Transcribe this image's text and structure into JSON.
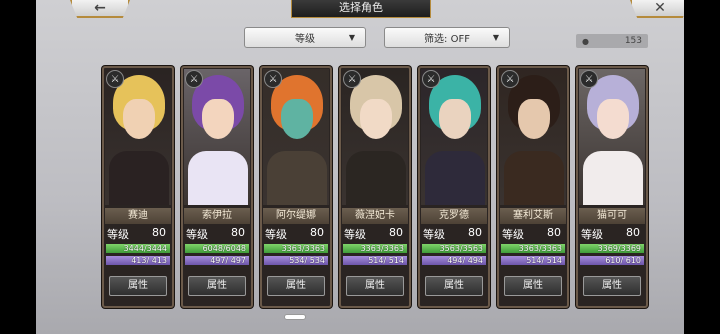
{
  "header": {
    "title": "选择角色",
    "back_icon": "←",
    "close_icon": "✕"
  },
  "controls": {
    "sort_label": "等级",
    "filter_label": "筛选: OFF",
    "dropdown_arrow": "▼",
    "character_count": "153",
    "person_icon": "👤"
  },
  "cards": [
    {
      "name": "赛迪",
      "level_label": "等级",
      "level": "80",
      "hp": "3444/3444",
      "mp": "413/ 413",
      "button": "属性",
      "hair": "#e6c25a",
      "skin": "#f0d1b3",
      "outfit": "#2a2222"
    },
    {
      "name": "索伊拉",
      "level_label": "等级",
      "level": "80",
      "hp": "6048/6048",
      "mp": "497/ 497",
      "button": "属性",
      "hair": "#7b4aa8",
      "skin": "#f3d5be",
      "outfit": "#e9e4f4"
    },
    {
      "name": "阿尔缇娜",
      "level_label": "等级",
      "level": "80",
      "hp": "3363/3363",
      "mp": "534/ 534",
      "button": "属性",
      "hair": "#e0742e",
      "skin": "#5fb3a2",
      "outfit": "#4a4036"
    },
    {
      "name": "薇涅妃卡",
      "level_label": "等级",
      "level": "80",
      "hp": "3363/3363",
      "mp": "514/ 514",
      "button": "属性",
      "hair": "#d8c6a8",
      "skin": "#f1dac6",
      "outfit": "#2b2622"
    },
    {
      "name": "克罗德",
      "level_label": "等级",
      "level": "80",
      "hp": "3563/3563",
      "mp": "494/ 494",
      "button": "属性",
      "hair": "#3bb3a6",
      "skin": "#ead3bf",
      "outfit": "#2e2a3a"
    },
    {
      "name": "塞利艾斯",
      "level_label": "等级",
      "level": "80",
      "hp": "3363/3363",
      "mp": "514/ 514",
      "button": "属性",
      "hair": "#2c1e18",
      "skin": "#e5c8ad",
      "outfit": "#3a2a20"
    },
    {
      "name": "猫可可",
      "level_label": "等级",
      "level": "80",
      "hp": "3369/3369",
      "mp": "610/ 610",
      "button": "属性",
      "hair": "#b7b0d8",
      "skin": "#f4dcd0",
      "outfit": "#f1ecec"
    }
  ]
}
